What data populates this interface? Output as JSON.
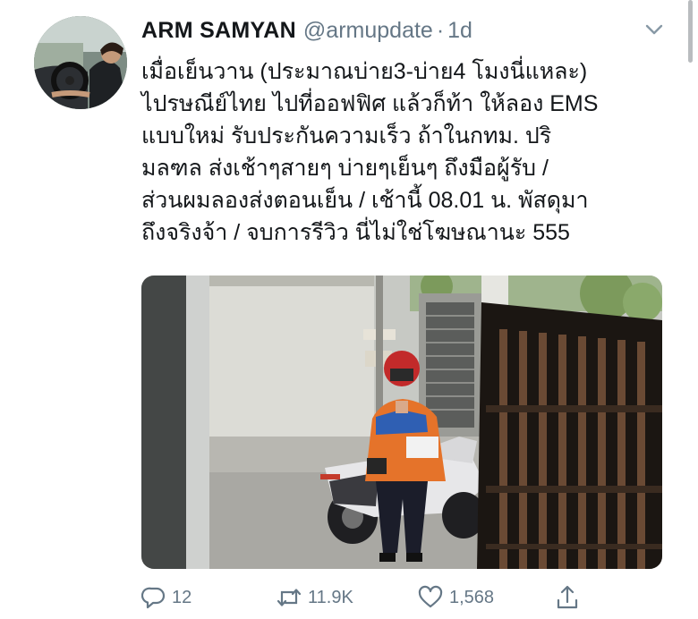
{
  "tweet": {
    "display_name": "ARM SAMYAN",
    "handle": "@armupdate",
    "separator": "·",
    "timestamp": "1d",
    "text_lines": [
      "เมื่อเย็นวาน (ประมาณบ่าย3-บ่าย4 โมงนี่แหละ)",
      "ไปรษณีย์ไทย ไปที่ออฟฟิศ แล้วก็ท้า ให้ลอง EMS",
      "แบบใหม่ รับประกันความเร็ว ถ้าในกทม. ปริ",
      "มลฑล ส่งเช้าๆสายๆ บ่ายๆเย็นๆ ถึงมือผู้รับ /",
      "ส่วนผมลองส่งตอนเย็น / เช้านี้ 08.01 น. พัสดุมา",
      "ถึงจริงจ้า / จบการรีวิว นี่ไม่ใช่โฆษณานะ 555"
    ],
    "media": {
      "kind": "photo",
      "icon": "photo-courier-on-scooter"
    },
    "actions": {
      "reply_count": "12",
      "retweet_count": "11.9K",
      "like_count": "1,568",
      "icons": [
        "reply-icon",
        "retweet-icon",
        "like-icon",
        "share-icon"
      ]
    }
  },
  "colors": {
    "text_primary": "#14171a",
    "text_secondary": "#657786",
    "background": "#ffffff"
  }
}
